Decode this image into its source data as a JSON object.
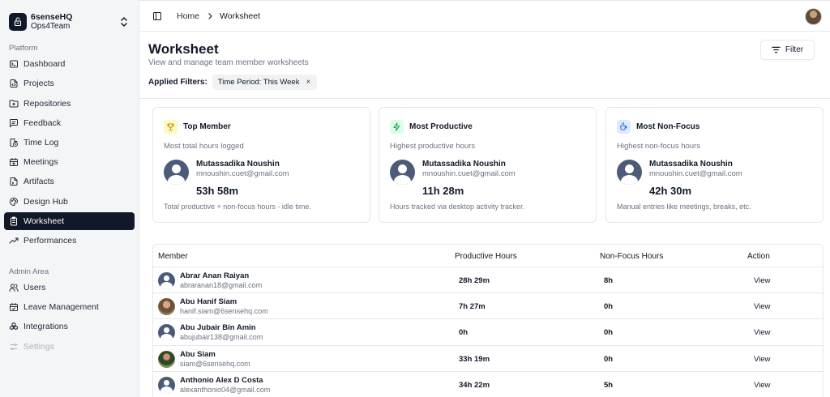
{
  "team": {
    "name": "6senseHQ",
    "plan": "Ops4Team"
  },
  "sidebar": {
    "platform_label": "Platform",
    "platform_items": [
      {
        "label": "Dashboard",
        "icon": "terminal-icon"
      },
      {
        "label": "Projects",
        "icon": "code-file-icon"
      },
      {
        "label": "Repositories",
        "icon": "folder-git-icon"
      },
      {
        "label": "Feedback",
        "icon": "message-square-icon"
      },
      {
        "label": "Time Log",
        "icon": "file-clock-icon"
      },
      {
        "label": "Meetings",
        "icon": "calendar-cog-icon"
      },
      {
        "label": "Artifacts",
        "icon": "file-code-icon"
      },
      {
        "label": "Design Hub",
        "icon": "palette-icon"
      },
      {
        "label": "Worksheet",
        "icon": "clipboard-list-icon",
        "active": true
      },
      {
        "label": "Performances",
        "icon": "trending-up-icon"
      }
    ],
    "admin_label": "Admin Area",
    "admin_items": [
      {
        "label": "Users",
        "icon": "users-icon"
      },
      {
        "label": "Leave Management",
        "icon": "calendar-check-icon"
      },
      {
        "label": "Integrations",
        "icon": "boxes-icon"
      },
      {
        "label": "Settings",
        "icon": "sliders-icon",
        "disabled": true
      }
    ]
  },
  "header": {
    "home": "Home",
    "current": "Worksheet"
  },
  "page": {
    "title": "Worksheet",
    "subtitle": "View and manage team member worksheets",
    "filter_button": "Filter",
    "applied_label": "Applied Filters:",
    "applied_chip": "Time Period: This Week",
    "chip_close": "×"
  },
  "cards": [
    {
      "title": "Top Member",
      "desc": "Most total hours logged",
      "name": "Mutassadika Noushin",
      "email": "mnoushin.cuet@gmail.com",
      "value": "53h 58m",
      "foot": "Total productive + non-focus hours - idle time.",
      "icon": "trophy-icon",
      "icon_color": "#ca8a04",
      "icon_bg": "#fef9c3"
    },
    {
      "title": "Most Productive",
      "desc": "Highest productive hours",
      "name": "Mutassadika Noushin",
      "email": "mnoushin.cuet@gmail.com",
      "value": "11h 28m",
      "foot": "Hours tracked via desktop activity tracker.",
      "icon": "zap-icon",
      "icon_color": "#16a34a",
      "icon_bg": "#dcfce7"
    },
    {
      "title": "Most Non-Focus",
      "desc": "Highest non-focus hours",
      "name": "Mutassadika Noushin",
      "email": "mnoushin.cuet@gmail.com",
      "value": "42h 30m",
      "foot": "Manual entries like meetings, breaks, etc.",
      "icon": "coffee-icon",
      "icon_color": "#2563eb",
      "icon_bg": "#dbeafe"
    }
  ],
  "table": {
    "headers": {
      "member": "Member",
      "productive": "Productive Hours",
      "nonfocus": "Non-Focus Hours",
      "action": "Action"
    },
    "rows": [
      {
        "name": "Abrar Anan Raiyan",
        "email": "abraranan18@gmail.com",
        "productive": "28h 29m",
        "nonfocus": "8h",
        "action": "View",
        "avatar": "default"
      },
      {
        "name": "Abu Hanif Siam",
        "email": "hanif.siam@6sensehq.com",
        "productive": "7h 27m",
        "nonfocus": "0h",
        "action": "View",
        "avatar": "photo1"
      },
      {
        "name": "Abu Jubair Bin Amin",
        "email": "abujubair138@gmail.com",
        "productive": "0h",
        "nonfocus": "0h",
        "action": "View",
        "avatar": "default"
      },
      {
        "name": "Abu Siam",
        "email": "siam@6sensehq.com",
        "productive": "33h 19m",
        "nonfocus": "0h",
        "action": "View",
        "avatar": "photo2"
      },
      {
        "name": "Anthonio Alex D Costa",
        "email": "alexanthonio04@gmail.com",
        "productive": "34h 22m",
        "nonfocus": "5h",
        "action": "View",
        "avatar": "default"
      }
    ]
  }
}
